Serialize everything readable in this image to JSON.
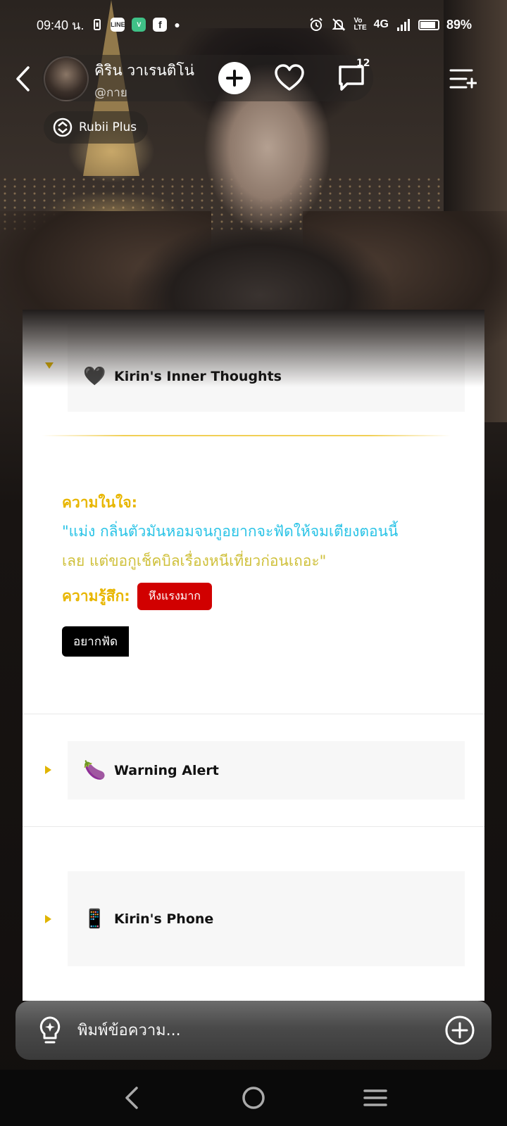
{
  "status_bar": {
    "time": "09:40 น.",
    "network": "4G",
    "battery": "89%",
    "battery_level": 0.89
  },
  "header": {
    "character_name": "คิริน วาเรนติโน่",
    "character_sub": "@กาย",
    "chat_count": "12",
    "rubii_label": "Rubii Plus"
  },
  "sections": [
    {
      "emoji": "🖤",
      "title": "Kirin's Inner Thoughts",
      "expanded": true
    },
    {
      "emoji": "🍆",
      "title": "Warning Alert",
      "expanded": false
    },
    {
      "emoji": "📱",
      "title": "Kirin's Phone",
      "expanded": false
    }
  ],
  "inner_thoughts": {
    "label": "ความในใจ:",
    "quote_line1": "\"แม่ง กลิ่นตัวมันหอมจนกูอยากจะฟัดให้จมเตียงตอนนี้",
    "quote_line2": "เลย แต่ขอกูเช็คบิลเรื่องหนีเที่ยวก่อนเถอะ\"",
    "feeling_label": "ความรู้สึก:",
    "feeling_badge": "หึงแรงมาก",
    "tag_badge": "อยากฟัด"
  },
  "input": {
    "placeholder": "พิมพ์ข้อความ..."
  },
  "colors": {
    "accent_gold": "#e8b600",
    "quote_cyan": "#29c3e6",
    "badge_red": "#d10000"
  }
}
